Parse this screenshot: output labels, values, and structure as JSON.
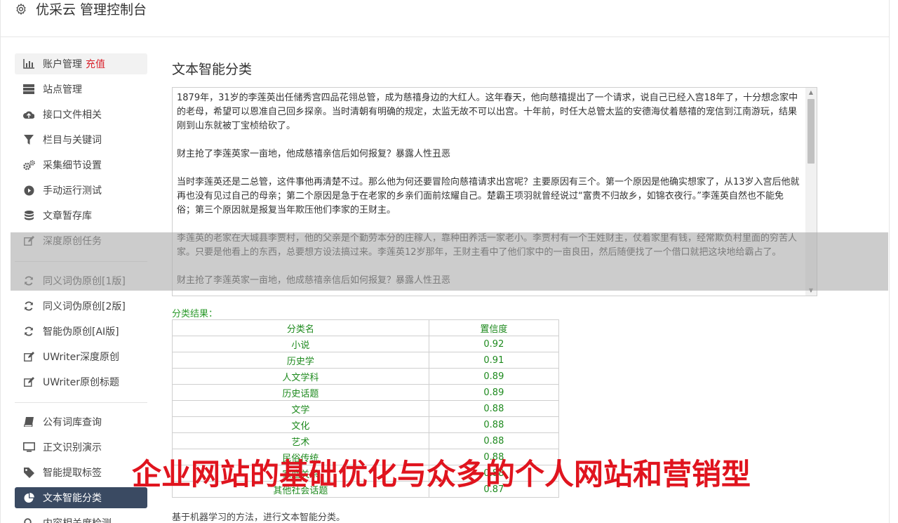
{
  "header": {
    "title": "优采云 管理控制台"
  },
  "sidebar": {
    "items": [
      {
        "label": "账户管理",
        "extra": "充值",
        "icon": "bar-chart-icon"
      },
      {
        "label": "站点管理",
        "icon": "server-icon"
      },
      {
        "label": "接口文件相关",
        "icon": "cloud-upload-icon"
      },
      {
        "label": "栏目与关键词",
        "icon": "filter-icon"
      },
      {
        "label": "采集细节设置",
        "icon": "gears-icon"
      },
      {
        "label": "手动运行测试",
        "icon": "play-circle-icon"
      },
      {
        "label": "文章暂存库",
        "icon": "database-icon"
      },
      {
        "label": "深度原创任务",
        "icon": "edit-icon"
      },
      {
        "label": "同义词伪原创[1版]",
        "icon": "refresh-icon"
      },
      {
        "label": "同义词伪原创[2版]",
        "icon": "refresh-icon"
      },
      {
        "label": "智能伪原创[AI版]",
        "icon": "refresh-icon"
      },
      {
        "label": "UWriter深度原创",
        "icon": "edit-icon"
      },
      {
        "label": "UWriter原创标题",
        "icon": "edit-icon"
      },
      {
        "label": "公有词库查询",
        "icon": "book-icon"
      },
      {
        "label": "正文识别演示",
        "icon": "monitor-icon"
      },
      {
        "label": "智能提取标签",
        "icon": "tag-icon"
      },
      {
        "label": "文本智能分类",
        "icon": "pie-chart-icon"
      },
      {
        "label": "内容相关度检测",
        "icon": "search-icon"
      }
    ]
  },
  "main": {
    "title": "文本智能分类",
    "text_paragraphs": [
      "1879年，31岁的李莲英出任储秀宫四品花翎总管，成为慈禧身边的大红人。这年春天，他向慈禧提出了一个请求，说自己已经入宫18年了，十分想念家中的老母，希望可以恩准自己回乡探亲。当时清朝有明确的规定，太监无故不可以出宫。十年前，时任大总管太监的安德海仗着慈禧的宠信到江南游玩，结果刚到山东就被丁宝桢给砍了。",
      "财主抢了李莲英家一亩地，他成慈禧亲信后如何报复？暴露人性丑恶",
      "当时李莲英还是二总管，这件事他再清楚不过。那么他为何还要冒险向慈禧请求出宫呢？主要原因有三个。第一个原因是他确实想家了，从13岁入宫后他就再也没有见过自己的母亲；第二个原因是急于在老家的乡亲们面前炫耀自己。楚霸王项羽就曾经说过“富贵不归故乡，如锦衣夜行。”李莲英自然也不能免俗；第三个原因就是报复当年欺压他们李家的王财主。",
      "李莲英的老家在大城县李贾村，他的父亲是个勤劳本分的庄稼人，靠种田养活一家老小。李贾村有一个王姓财主，仗着家里有钱，经常欺负村里面的穷苦人家。只要是他看上的东西，总要想方设法搞过来。李莲英12岁那年，王财主看中了他们家中的一亩良田，然后随便找了一个借口就把这块地给霸占了。",
      "财主抢了李莲英家一亩地，他成慈禧亲信后如何报复？暴露人性丑恶"
    ],
    "result_label": "分类结果：",
    "table": {
      "headers": [
        "分类名",
        "置信度"
      ],
      "rows": [
        [
          "小说",
          "0.92"
        ],
        [
          "历史学",
          "0.91"
        ],
        [
          "人文学科",
          "0.89"
        ],
        [
          "历史话题",
          "0.89"
        ],
        [
          "文学",
          "0.88"
        ],
        [
          "文化",
          "0.88"
        ],
        [
          "艺术",
          "0.88"
        ],
        [
          "民俗传统",
          "0.88"
        ],
        [
          "家庭关系",
          "0.88"
        ],
        [
          "其他社会话题",
          "0.87"
        ]
      ]
    },
    "footer_note": "基于机器学习的方法，进行文本智能分类。"
  },
  "banner": {
    "text": "企业网站的基础优化与众多的个人网站和营销型"
  },
  "colors": {
    "active_nav": "#3a4a62",
    "result_green": "#1e8a1e",
    "recharge_red": "#d9232d",
    "banner_red": "#e0141e"
  }
}
